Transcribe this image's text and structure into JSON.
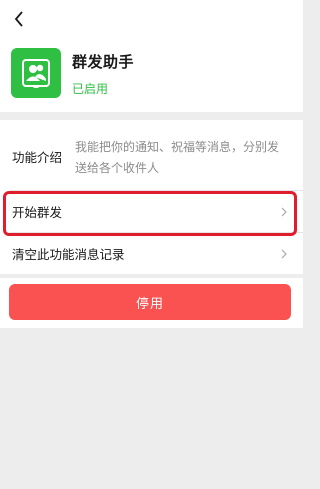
{
  "header": {
    "back_icon": "chevron-left-icon"
  },
  "app": {
    "icon": "group-users-icon",
    "name": "群发助手",
    "status": "已启用",
    "accent": "#2fbf43"
  },
  "intro": {
    "label": "功能介绍",
    "text": "我能把你的通知、祝福等消息，分别发送给各个收件人"
  },
  "actions": {
    "start_mass_send": "开始群发",
    "clear_records": "清空此功能消息记录"
  },
  "stop_button": {
    "label": "停用",
    "color": "#fa5151"
  },
  "highlight_color": "#e01d2d"
}
